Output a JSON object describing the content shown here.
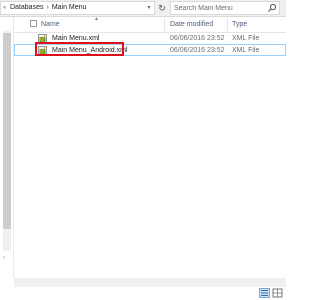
{
  "address_bar": {
    "breadcrumb": [
      "Databases",
      "Main Menu"
    ],
    "search_placeholder": "Search Main Menu"
  },
  "columns": {
    "name": "Name",
    "date_modified": "Date modified",
    "type": "Type"
  },
  "files": [
    {
      "name": "Main Menu.xml",
      "date": "06/06/2016 23:52",
      "type": "XML File",
      "selected": false
    },
    {
      "name": "Main Menu_Android.xml",
      "date": "06/06/2016 23:52",
      "type": "XML File",
      "selected": true
    }
  ],
  "icons": {
    "file": "xml-document-icon",
    "search": "search-icon",
    "refresh": "refresh-icon"
  },
  "colors": {
    "highlight_box": "#e0101a",
    "selection_border": "#99d1ff",
    "header_text": "#4c607a"
  }
}
